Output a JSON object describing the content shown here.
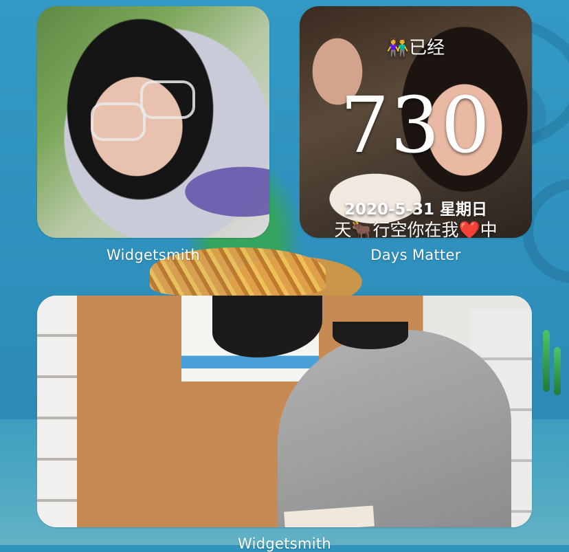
{
  "widgets": [
    {
      "app_label": "Widgetsmith"
    },
    {
      "app_label": "Days Matter",
      "header": "👫已经",
      "count": "730",
      "date": "2020-5-31 星期日",
      "caption": "天🐂行空你在我❤️中"
    },
    {
      "app_label": "Widgetsmith"
    }
  ],
  "colors": {
    "wallpaper": "#2f93be",
    "label_text": "#ffffff"
  }
}
